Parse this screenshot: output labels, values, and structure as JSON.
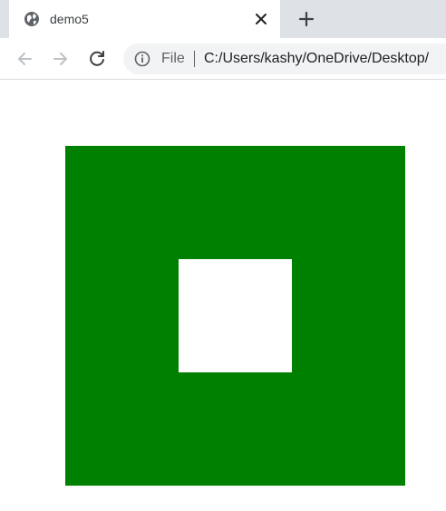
{
  "tab": {
    "title": "demo5",
    "icon": "globe-icon",
    "close_icon": "close-icon"
  },
  "new_tab_icon": "plus-icon",
  "toolbar": {
    "back_icon": "arrow-left-icon",
    "forward_icon": "arrow-right-icon",
    "reload_icon": "reload-icon",
    "info_icon": "info-icon",
    "scheme_label": "File",
    "url": "C:/Users/kashy/OneDrive/Desktop/"
  },
  "colors": {
    "outer_square": "#008000",
    "inner_square": "#ffffff",
    "page_background": "#ffffff"
  }
}
